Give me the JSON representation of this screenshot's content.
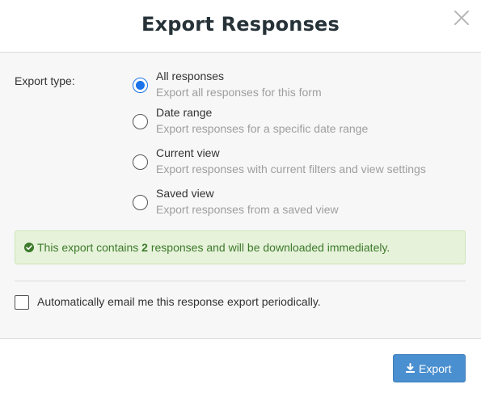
{
  "dialog": {
    "title": "Export Responses"
  },
  "export_type": {
    "label": "Export type:",
    "options": [
      {
        "title": "All responses",
        "description": "Export all responses for this form",
        "selected": true
      },
      {
        "title": "Date range",
        "description": "Export responses for a specific date range",
        "selected": false
      },
      {
        "title": "Current view",
        "description": "Export responses with current filters and view settings",
        "selected": false
      },
      {
        "title": "Saved view",
        "description": "Export responses from a saved view",
        "selected": false
      }
    ]
  },
  "alert": {
    "icon": "check-circle-icon",
    "text_before": "This export contains ",
    "count": "2",
    "text_after": " responses and will be downloaded immediately.",
    "color": "#3d7a2b",
    "background": "#e6f2da"
  },
  "auto_email": {
    "label": "Automatically email me this response export periodically.",
    "checked": false
  },
  "footer": {
    "export_label": "Export",
    "export_icon": "download-icon",
    "button_color": "#4a8fcf"
  },
  "colors": {
    "accent": "#1a73e8"
  }
}
